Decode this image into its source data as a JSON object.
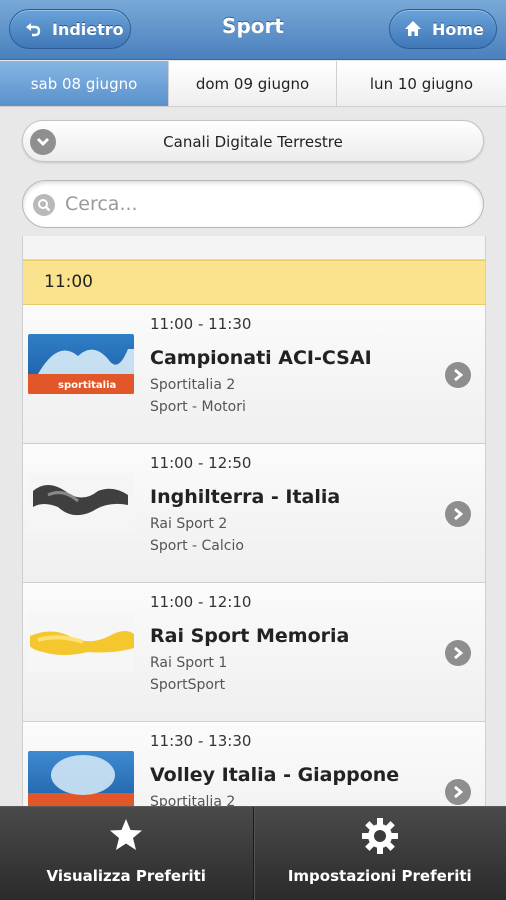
{
  "header": {
    "title": "Sport",
    "back_label": "Indietro",
    "home_label": "Home"
  },
  "date_tabs": [
    {
      "label": "sab 08 giugno",
      "active": true
    },
    {
      "label": "dom 09 giugno",
      "active": false
    },
    {
      "label": "lun 10 giugno",
      "active": false
    }
  ],
  "channel_select": {
    "label": "Canali Digitale Terrestre"
  },
  "search": {
    "placeholder": "Cerca..."
  },
  "list": {
    "time_divider": "11:00",
    "items": [
      {
        "time": "11:00 - 11:30",
        "title": "Campionati ACI-CSAI",
        "channel": "Sportitalia 2",
        "genre": "Sport - Motori"
      },
      {
        "time": "11:00 - 12:50",
        "title": "Inghilterra - Italia",
        "channel": "Rai Sport 2",
        "genre": "Sport - Calcio"
      },
      {
        "time": "11:00 - 12:10",
        "title": "Rai Sport Memoria",
        "channel": "Rai Sport 1",
        "genre": "SportSport"
      },
      {
        "time": "11:30 - 13:30",
        "title": "Volley Italia - Giappone",
        "channel": "Sportitalia 2",
        "genre": ""
      }
    ]
  },
  "bottom_bar": {
    "favorites_label": "Visualizza Preferiti",
    "settings_label": "Impostazioni Preferiti"
  },
  "colors": {
    "header": "#4a80bd",
    "active_tab": "#5a91cc",
    "divider": "#fbe38e",
    "bottom_bar": "#2b2b2b"
  }
}
